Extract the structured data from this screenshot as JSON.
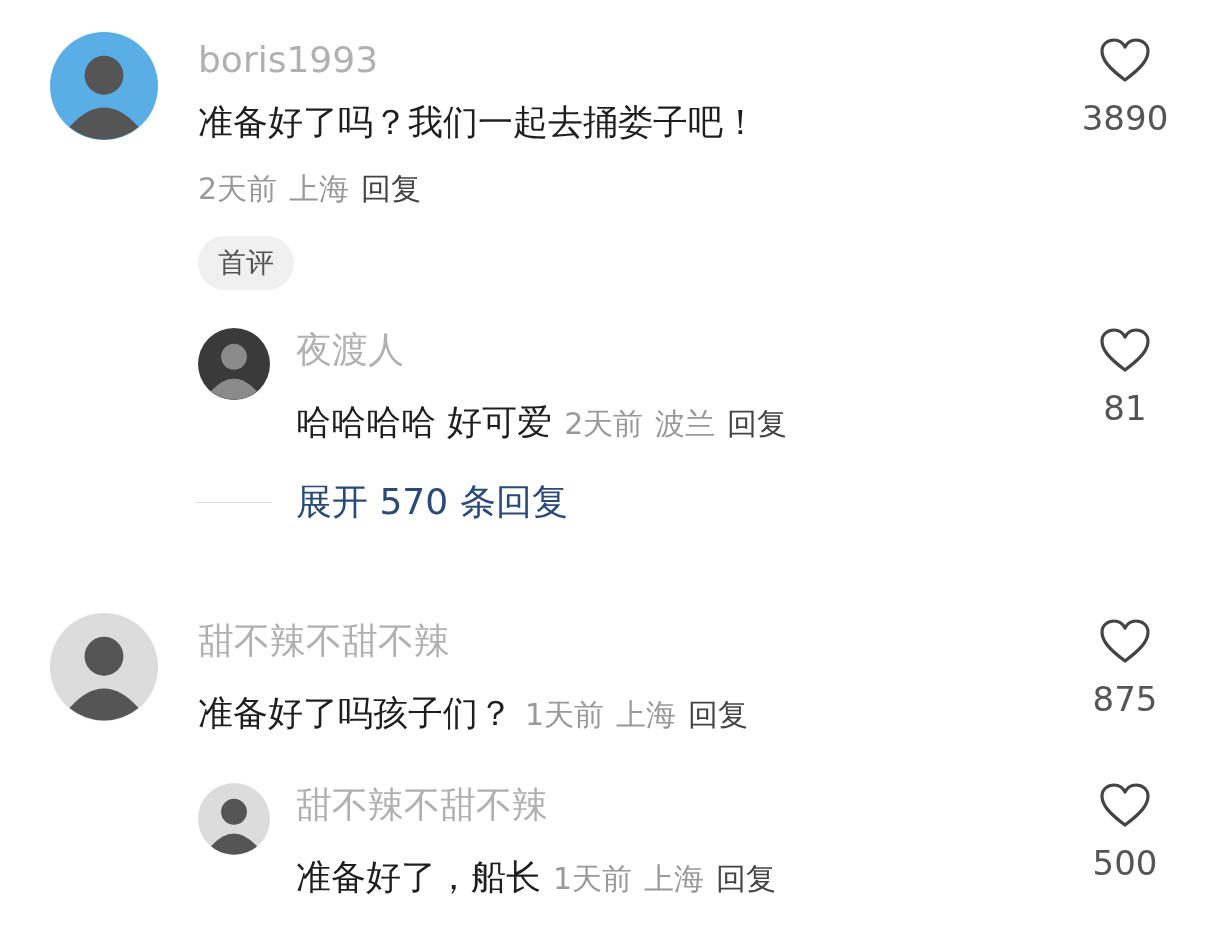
{
  "comments": [
    {
      "avatar": {
        "color": "#5aaee6"
      },
      "name": "boris1993",
      "text": "准备好了吗？我们一起去捅娄子吧！",
      "kind": "stacked",
      "time": "2天前",
      "location": "上海",
      "reply": "回复",
      "likes": "3890",
      "badge": "首评",
      "replies": [
        {
          "avatar": {
            "color": "#3a3a3a"
          },
          "name": "夜渡人",
          "text": "哈哈哈哈 好可爱",
          "time": "2天前",
          "location": "波兰",
          "reply": "回复",
          "likes": "81"
        }
      ],
      "expand": "展开 570 条回复"
    },
    {
      "avatar": {
        "color": "#dcdcdc"
      },
      "name": "甜不辣不甜不辣",
      "text": "准备好了吗孩子们？",
      "kind": "inline",
      "time": "1天前",
      "location": "上海",
      "reply": "回复",
      "likes": "875",
      "replies": [
        {
          "avatar": {
            "color": "#dcdcdc"
          },
          "name": "甜不辣不甜不辣",
          "text": "准备好了，船长",
          "time": "1天前",
          "location": "上海",
          "reply": "回复",
          "likes": "500"
        }
      ]
    }
  ]
}
